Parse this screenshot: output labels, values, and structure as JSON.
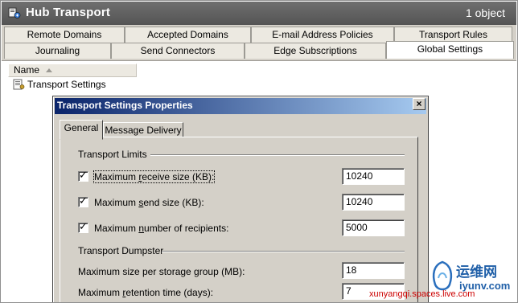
{
  "header": {
    "title": "Hub Transport",
    "count": "1 object",
    "icon": "transport-icon"
  },
  "tabs_row1": [
    "Remote Domains",
    "Accepted Domains",
    "E-mail Address Policies",
    "Transport Rules"
  ],
  "tabs_row2": [
    "Journaling",
    "Send Connectors",
    "Edge Subscriptions",
    "Global Settings"
  ],
  "active_tab": "Global Settings",
  "list": {
    "column_header": "Name",
    "items": [
      "Transport Settings"
    ]
  },
  "dialog": {
    "title": "Transport Settings Properties",
    "close": "×",
    "tabs": [
      "General",
      "Message Delivery"
    ],
    "active_tab": "General",
    "limits_group": "Transport Limits",
    "max_receive": {
      "label_pre": "Maximum ",
      "label_u": "r",
      "label_post": "eceive size (KB):",
      "checked": true,
      "value": "10240"
    },
    "max_send": {
      "label_pre": "Maximum ",
      "label_u": "s",
      "label_post": "end size (KB):",
      "checked": true,
      "value": "10240"
    },
    "max_recipients": {
      "label_pre": "Maximum ",
      "label_u": "n",
      "label_post": "umber of recipients:",
      "checked": true,
      "value": "5000"
    },
    "dumpster_group": "Transport Dumpster",
    "max_storage": {
      "label": "Maximum size per storage group (MB):",
      "value": "18"
    },
    "max_retention": {
      "label_pre": "Maximum ",
      "label_u": "r",
      "label_post": "etention time (days):",
      "value": "7"
    }
  },
  "watermark": {
    "cn": "运维网",
    "url": "iyunv.com",
    "source": "xunyangqi.spaces.live.com"
  }
}
